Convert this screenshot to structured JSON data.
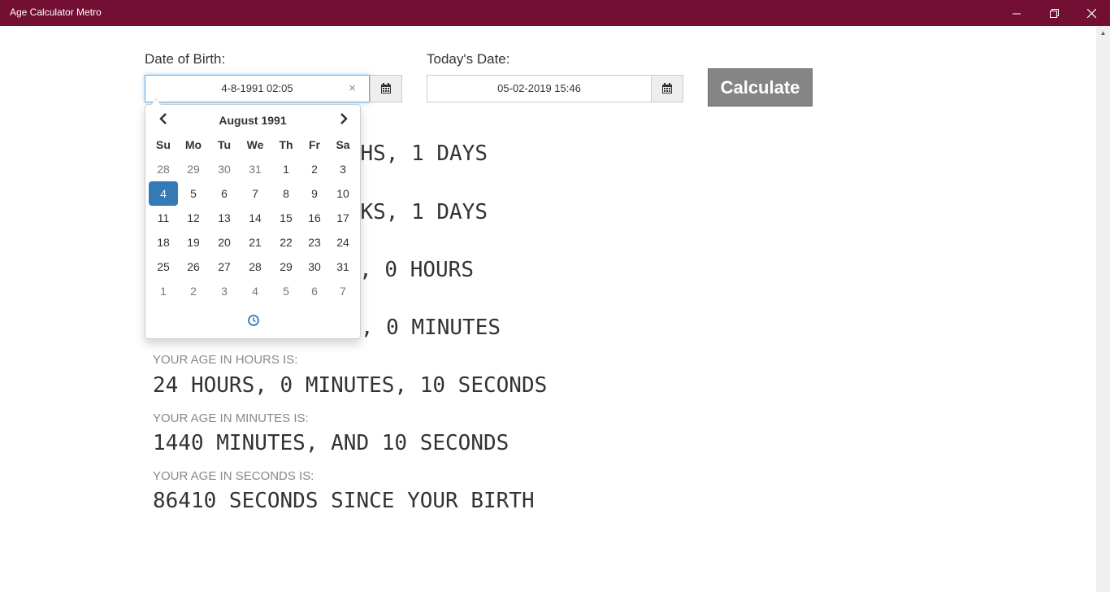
{
  "window": {
    "title": "Age Calculator Metro"
  },
  "form": {
    "dob_label": "Date of Birth:",
    "dob_value": "4-8-1991 02:05",
    "today_label": "Today's Date:",
    "today_value": "05-02-2019 15:46",
    "calculate_label": "Calculate",
    "clear_glyph": "×"
  },
  "results": {
    "line1": "HS, 1 DAYS",
    "line2": "KS, 1 DAYS",
    "line3": ", 0 HOURS",
    "line4": ", 0 MINUTES",
    "hours_caption": "YOUR AGE IN HOURS IS:",
    "hours_value": "24 HOURS, 0 MINUTES, 10 SECONDS",
    "minutes_caption": "YOUR AGE IN MINUTES IS:",
    "minutes_value": "1440 MINUTES, AND 10 SECONDS",
    "seconds_caption": "YOUR AGE IN SECONDS IS:",
    "seconds_value": "86410 SECONDS SINCE YOUR BIRTH"
  },
  "calendar": {
    "month_label": "August 1991",
    "weekdays": [
      "Su",
      "Mo",
      "Tu",
      "We",
      "Th",
      "Fr",
      "Sa"
    ],
    "weeks": [
      [
        {
          "d": "28",
          "old": true
        },
        {
          "d": "29",
          "old": true
        },
        {
          "d": "30",
          "old": true
        },
        {
          "d": "31",
          "old": true
        },
        {
          "d": "1"
        },
        {
          "d": "2"
        },
        {
          "d": "3"
        }
      ],
      [
        {
          "d": "4",
          "active": true
        },
        {
          "d": "5"
        },
        {
          "d": "6"
        },
        {
          "d": "7"
        },
        {
          "d": "8"
        },
        {
          "d": "9"
        },
        {
          "d": "10"
        }
      ],
      [
        {
          "d": "11"
        },
        {
          "d": "12"
        },
        {
          "d": "13"
        },
        {
          "d": "14"
        },
        {
          "d": "15"
        },
        {
          "d": "16"
        },
        {
          "d": "17"
        }
      ],
      [
        {
          "d": "18"
        },
        {
          "d": "19"
        },
        {
          "d": "20"
        },
        {
          "d": "21"
        },
        {
          "d": "22"
        },
        {
          "d": "23"
        },
        {
          "d": "24"
        }
      ],
      [
        {
          "d": "25"
        },
        {
          "d": "26"
        },
        {
          "d": "27"
        },
        {
          "d": "28"
        },
        {
          "d": "29"
        },
        {
          "d": "30"
        },
        {
          "d": "31"
        }
      ],
      [
        {
          "d": "1",
          "old": true
        },
        {
          "d": "2",
          "old": true
        },
        {
          "d": "3",
          "old": true
        },
        {
          "d": "4",
          "old": true
        },
        {
          "d": "5",
          "old": true
        },
        {
          "d": "6",
          "old": true
        },
        {
          "d": "7",
          "old": true
        }
      ]
    ]
  },
  "colors": {
    "titlebar": "#730f33",
    "selected_day": "#337ab7",
    "button": "#858585"
  },
  "icons": {
    "calendar": "calendar-icon",
    "clock": "clock-icon",
    "prev": "chevron-left-icon",
    "next": "chevron-right-icon"
  }
}
